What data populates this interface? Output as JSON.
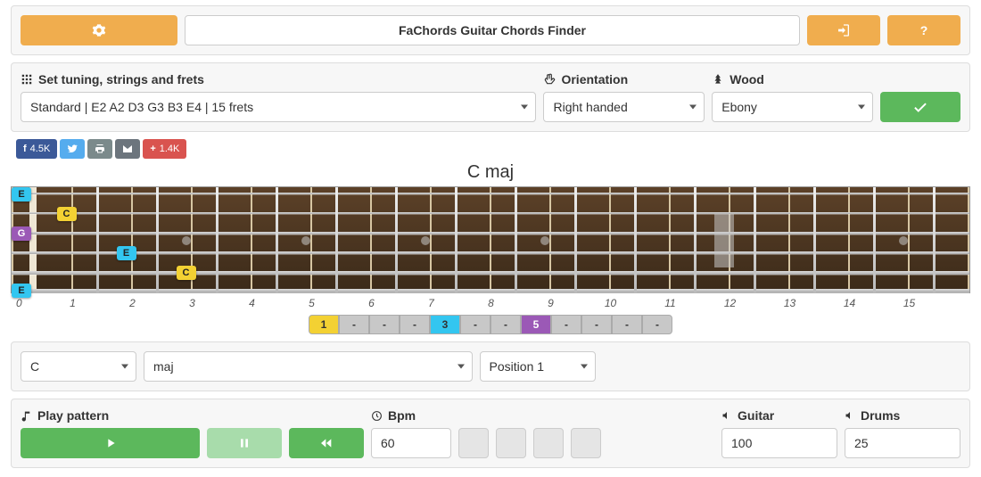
{
  "header": {
    "title": "FaChords Guitar Chords Finder"
  },
  "settings": {
    "tuning_label": "Set tuning, strings and frets",
    "tuning_value": "Standard | E2 A2 D3 G3 B3 E4 | 15 frets",
    "orientation_label": "Orientation",
    "orientation_value": "Right handed",
    "wood_label": "Wood",
    "wood_value": "Ebony"
  },
  "share": {
    "facebook": "4.5K",
    "addthis": "1.4K"
  },
  "chord": {
    "name": "C maj",
    "fret_numbers": [
      "0",
      "1",
      "2",
      "3",
      "4",
      "5",
      "6",
      "7",
      "8",
      "9",
      "10",
      "11",
      "12",
      "13",
      "14",
      "15"
    ],
    "intervals": [
      "1",
      "-",
      "-",
      "-",
      "3",
      "-",
      "-",
      "5",
      "-",
      "-",
      "-",
      "-"
    ],
    "notes": [
      {
        "label": "E",
        "cls": "blue",
        "string": 1,
        "fret": 0
      },
      {
        "label": "C",
        "cls": "yellow",
        "string": 2,
        "fret": 1
      },
      {
        "label": "G",
        "cls": "purple",
        "string": 3,
        "fret": 0
      },
      {
        "label": "E",
        "cls": "blue",
        "string": 4,
        "fret": 2
      },
      {
        "label": "C",
        "cls": "yellow",
        "string": 5,
        "fret": 3
      },
      {
        "label": "E",
        "cls": "blue",
        "string": 6,
        "fret": 0
      }
    ]
  },
  "chord_select": {
    "root": "C",
    "quality": "maj",
    "position": "Position 1"
  },
  "play": {
    "pattern_label": "Play pattern",
    "bpm_label": "Bpm",
    "bpm_value": "60",
    "guitar_label": "Guitar",
    "guitar_value": "100",
    "drums_label": "Drums",
    "drums_value": "25"
  }
}
